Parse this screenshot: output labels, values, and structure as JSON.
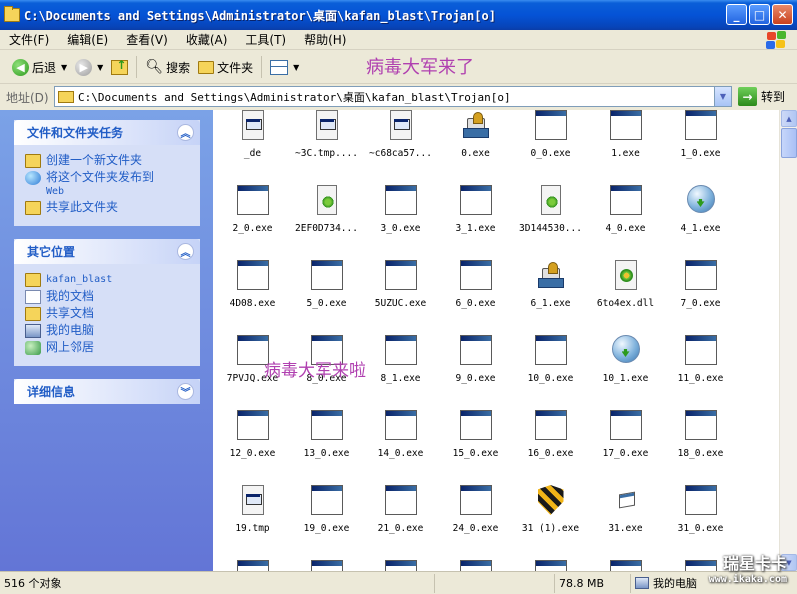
{
  "window": {
    "title": "C:\\Documents and Settings\\Administrator\\桌面\\kafan_blast\\Trojan[o]",
    "min_glyph": "_",
    "max_glyph": "□",
    "close_glyph": "✕"
  },
  "menu": [
    "文件(F)",
    "编辑(E)",
    "查看(V)",
    "收藏(A)",
    "工具(T)",
    "帮助(H)"
  ],
  "toolbar": {
    "back_label": "后退",
    "search_label": "搜索",
    "folders_label": "文件夹"
  },
  "banner_text": "病毒大军来了",
  "overlay_text": "病毒大军来啦",
  "address": {
    "label": "地址(D)",
    "value": "C:\\Documents and Settings\\Administrator\\桌面\\kafan_blast\\Trojan[o]",
    "go_label": "转到"
  },
  "left_pane": {
    "tasks_title": "文件和文件夹任务",
    "tasks": [
      "创建一个新文件夹",
      "将这个文件夹发布到",
      "Web",
      "共享此文件夹"
    ],
    "places_title": "其它位置",
    "places": [
      "kafan_blast",
      "我的文档",
      "共享文档",
      "我的电脑",
      "网上邻居"
    ],
    "details_title": "详细信息"
  },
  "files": [
    {
      "name": "_de",
      "icon": "doc"
    },
    {
      "name": "~3C.tmp....",
      "icon": "doc"
    },
    {
      "name": "~c68ca57...",
      "icon": "doc"
    },
    {
      "name": "0.exe",
      "icon": "install"
    },
    {
      "name": "0_0.exe",
      "icon": "win"
    },
    {
      "name": "1.exe",
      "icon": "win"
    },
    {
      "name": "1_0.exe",
      "icon": "win"
    },
    {
      "name": "2_0.exe",
      "icon": "win"
    },
    {
      "name": "2EF0D734...",
      "icon": "setup"
    },
    {
      "name": "3_0.exe",
      "icon": "win"
    },
    {
      "name": "3_1.exe",
      "icon": "win"
    },
    {
      "name": "3D144530...",
      "icon": "setup"
    },
    {
      "name": "4_0.exe",
      "icon": "win"
    },
    {
      "name": "4_1.exe",
      "icon": "globe"
    },
    {
      "name": "4D08.exe",
      "icon": "win"
    },
    {
      "name": "5_0.exe",
      "icon": "win"
    },
    {
      "name": "5UZUC.exe",
      "icon": "win"
    },
    {
      "name": "6_0.exe",
      "icon": "win"
    },
    {
      "name": "6_1.exe",
      "icon": "install"
    },
    {
      "name": "6to4ex.dll",
      "icon": "dll"
    },
    {
      "name": "7_0.exe",
      "icon": "win"
    },
    {
      "name": "7PVJQ.exe",
      "icon": "win"
    },
    {
      "name": "8_0.exe",
      "icon": "win"
    },
    {
      "name": "8_1.exe",
      "icon": "win"
    },
    {
      "name": "9_0.exe",
      "icon": "win"
    },
    {
      "name": "10_0.exe",
      "icon": "win"
    },
    {
      "name": "10_1.exe",
      "icon": "globe"
    },
    {
      "name": "11_0.exe",
      "icon": "win"
    },
    {
      "name": "12_0.exe",
      "icon": "win"
    },
    {
      "name": "13_0.exe",
      "icon": "win"
    },
    {
      "name": "14_0.exe",
      "icon": "win"
    },
    {
      "name": "15_0.exe",
      "icon": "win"
    },
    {
      "name": "16_0.exe",
      "icon": "win"
    },
    {
      "name": "17_0.exe",
      "icon": "win"
    },
    {
      "name": "18_0.exe",
      "icon": "win"
    },
    {
      "name": "19.tmp",
      "icon": "doc"
    },
    {
      "name": "19_0.exe",
      "icon": "win"
    },
    {
      "name": "21_0.exe",
      "icon": "win"
    },
    {
      "name": "24_0.exe",
      "icon": "win"
    },
    {
      "name": "31 (1).exe",
      "icon": "shield"
    },
    {
      "name": "31.exe",
      "icon": "small"
    },
    {
      "name": "31_0.exe",
      "icon": "win"
    }
  ],
  "status": {
    "count": "516 个对象",
    "size": "78.8 MB",
    "location": "我的电脑"
  },
  "watermark": {
    "line1": "瑞星卡卡",
    "line2": "www.ikaka.com"
  }
}
